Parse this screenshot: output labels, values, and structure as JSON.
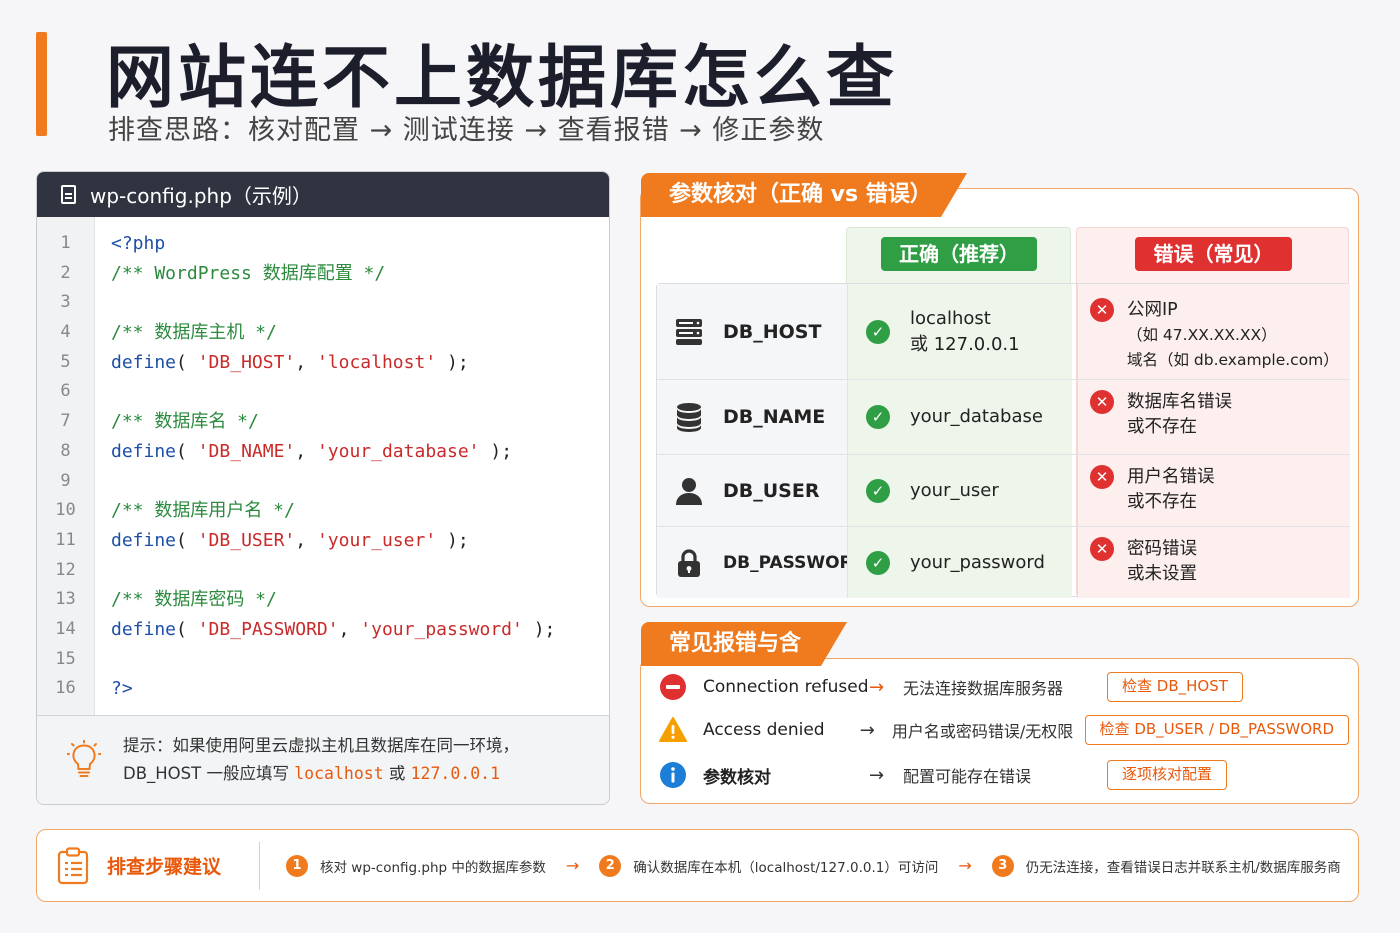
{
  "header": {
    "title": "网站连不上数据库怎么查",
    "subtitle": "排查思路：核对配置 → 测试连接 → 查看报错 → 修正参数"
  },
  "code_panel": {
    "filename": "wp-config.php（示例）",
    "line_numbers": [
      "1",
      "2",
      "3",
      "4",
      "5",
      "6",
      "7",
      "8",
      "9",
      "10",
      "11",
      "12",
      "13",
      "14",
      "15",
      "16"
    ],
    "lines": {
      "l1": "<?php",
      "l2": "/** WordPress 数据库配置 */",
      "l4": "/** 数据库主机 */",
      "l5_kw": "define",
      "l5_key": "'DB_HOST'",
      "l5_val": "'localhost'",
      "l7": "/** 数据库名 */",
      "l8_kw": "define",
      "l8_key": "'DB_NAME'",
      "l8_val": "'your_database'",
      "l10": "/** 数据库用户名 */",
      "l11_kw": "define",
      "l11_key": "'DB_USER'",
      "l11_val": "'your_user'",
      "l13": "/** 数据库密码 */",
      "l14_kw": "define",
      "l14_key": "'DB_PASSWORD'",
      "l14_val": "'your_password'",
      "l16": "?>"
    },
    "tip": {
      "line1": "提示：如果使用阿里云虚拟主机且数据库在同一环境，",
      "line2_a": "DB_HOST 一般应填写 ",
      "line2_b": "localhost",
      "line2_c": " 或 ",
      "line2_d": "127.0.0.1"
    }
  },
  "params": {
    "title": "参数核对（正确 vs 错误）",
    "good_header": "正确（推荐）",
    "bad_header": "错误（常见）",
    "rows": [
      {
        "name": "DB_HOST",
        "icon": "server-icon",
        "good": [
          "localhost",
          "或 127.0.0.1"
        ],
        "bad": [
          "公网IP",
          "（如 47.XX.XX.XX）",
          "域名（如 db.example.com）"
        ]
      },
      {
        "name": "DB_NAME",
        "icon": "database-icon",
        "good": [
          "your_database"
        ],
        "bad": [
          "数据库名错误",
          "或不存在"
        ]
      },
      {
        "name": "DB_USER",
        "icon": "user-icon",
        "good": [
          "your_user"
        ],
        "bad": [
          "用户名错误",
          "或不存在"
        ]
      },
      {
        "name": "DB_PASSWORD",
        "icon": "lock-icon",
        "good": [
          "your_password"
        ],
        "bad": [
          "密码错误",
          "或未设置"
        ]
      }
    ]
  },
  "errors": {
    "title": "常见报错与含义",
    "rows": [
      {
        "icon": "stop-icon",
        "label": "Connection refused",
        "arrow": "→",
        "meaning": "无法连接数据库服务器",
        "action": "检查 DB_HOST"
      },
      {
        "icon": "warning-icon",
        "label": "Access denied",
        "arrow": "→",
        "meaning": "用户名或密码错误/无权限",
        "action": "检查 DB_USER / DB_PASSWORD"
      },
      {
        "icon": "info-icon",
        "label": "参数核对",
        "arrow": "→",
        "meaning": "配置可能存在错误",
        "action": "逐项核对配置"
      }
    ]
  },
  "steps": {
    "title": "排查步骤建议",
    "items": [
      {
        "num": "1",
        "text": "核对 wp-config.php 中的数据库参数"
      },
      {
        "num": "2",
        "text": "确认数据库在本机（localhost/127.0.0.1）可访问"
      },
      {
        "num": "3",
        "text": "仍无法连接，查看错误日志并联系主机/数据库服务商"
      }
    ],
    "arrow": "→"
  },
  "colors": {
    "accent": "#f07b1e",
    "good": "#2f9e44",
    "bad": "#e03131",
    "code_header": "#2f3440"
  }
}
